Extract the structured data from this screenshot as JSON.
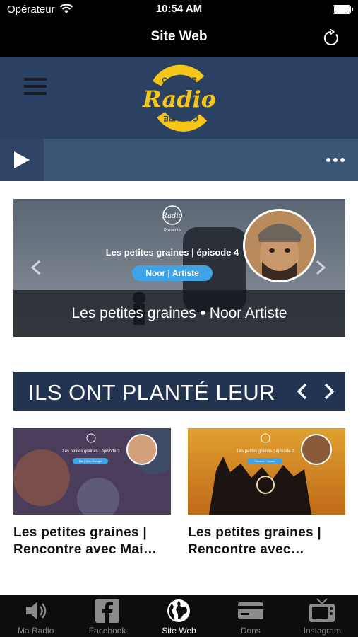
{
  "status_bar": {
    "carrier": "Opérateur",
    "time": "10:54 AM"
  },
  "nav": {
    "title": "Site Web"
  },
  "header": {
    "logo_top": "COVIVRE",
    "logo_main": "Radio",
    "logo_bottom": "COVIVRE"
  },
  "slider": {
    "presents": "Présente",
    "heading": "Les petites graines | épisode 4",
    "pill": "Noor | Artiste",
    "caption": "Les petites graines • Noor Artiste"
  },
  "section": {
    "title": "ILS ONT PLANTÉ LEUR"
  },
  "cards": [
    {
      "thumb_heading": "Les petites graines | épisode 3",
      "thumb_pill": "Mai | Soin Énergie",
      "title_line1": "Les petites graines |",
      "title_line2": "Rencontre avec Mai…"
    },
    {
      "thumb_heading": "Les petites graines | épisode 2",
      "thumb_pill": "Passion · Coach",
      "title_line1": "Les petites graines |",
      "title_line2": "Rencontre avec…"
    }
  ],
  "tabs": [
    {
      "label": "Ma Radio",
      "icon": "speaker-icon",
      "active": false
    },
    {
      "label": "Facebook",
      "icon": "facebook-icon",
      "active": false
    },
    {
      "label": "Site Web",
      "icon": "globe-icon",
      "active": true
    },
    {
      "label": "Dons",
      "icon": "credit-card-icon",
      "active": false
    },
    {
      "label": "Instagram",
      "icon": "tv-icon",
      "active": false
    }
  ],
  "colors": {
    "header_bg": "#2a4163",
    "player_bg": "#3b5577",
    "section_bg": "#233453",
    "logo_yellow": "#f5c518",
    "pill_blue": "#3ea3e6"
  }
}
